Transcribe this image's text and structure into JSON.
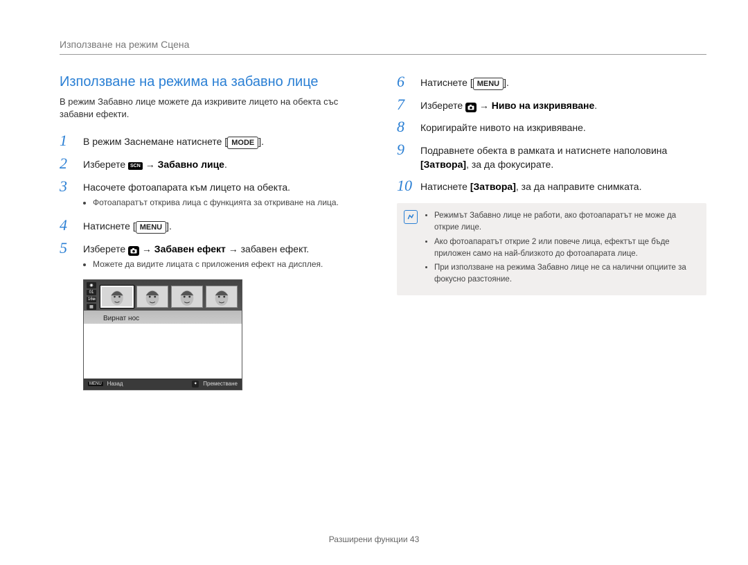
{
  "header": {
    "breadcrumb": "Използване на режим Сцена"
  },
  "section": {
    "title": "Използване на режима на забавно лице",
    "intro": "В режим Забавно лице можете да изкривите лицето на обекта със забавни ефекти."
  },
  "labels": {
    "mode": "MODE",
    "menu": "MENU",
    "arrow": "→",
    "scn": "SCN"
  },
  "left_steps": [
    {
      "n": "1",
      "pre": "В режим Заснемане натиснете ",
      "btn": "mode",
      "post": "."
    },
    {
      "n": "2",
      "pre": "Изберете ",
      "icon": "scn",
      "post_bold": " Забавно лице",
      "trail": "."
    },
    {
      "n": "3",
      "pre": "Насочете фотоапарата към лицето на обекта.",
      "bullets": [
        "Фотоапаратът открива лица с функцията за откриване на лица."
      ]
    },
    {
      "n": "4",
      "pre": "Натиснете ",
      "btn": "menu",
      "post": "."
    },
    {
      "n": "5",
      "pre": "Изберете ",
      "icon": "cam",
      "post_bold": " Забавен ефект",
      "mid": " → забавен ефект.",
      "bullets": [
        "Можете да видите лицата с приложения ефект на дисплея."
      ]
    }
  ],
  "right_steps": [
    {
      "n": "6",
      "pre": "Натиснете ",
      "btn": "menu",
      "post": "."
    },
    {
      "n": "7",
      "pre": "Изберете ",
      "icon": "cam",
      "post_bold": " Ниво на изкривяване",
      "trail": "."
    },
    {
      "n": "8",
      "pre": "Коригирайте нивото на изкривяване."
    },
    {
      "n": "9",
      "pre": "Подравнете обекта в рамката и натиснете наполовина ",
      "bold2": "[Затвора]",
      "post2": ", за да фокусирате."
    },
    {
      "n": "10",
      "pre": "Натиснете ",
      "bold2": "[Затвора]",
      "post2": ", за да направите снимката."
    }
  ],
  "lcd": {
    "label": "Вирнат нос",
    "back_key": "MENU",
    "back_label": "Назад",
    "move_label": "Преместване",
    "side_icons": [
      "◉",
      "01",
      "16м",
      "▦"
    ]
  },
  "note": {
    "items": [
      "Режимът Забавно лице не работи, ако фотоапаратът не може да открие лице.",
      "Ако фотоапаратът открие 2 или повече лица, ефектът ще бъде приложен само на най-близкото до фотоапарата лице.",
      "При използване на режима Забавно лице не са налични опциите за фокусно разстояние."
    ]
  },
  "footer": {
    "text": "Разширени функции  43"
  }
}
